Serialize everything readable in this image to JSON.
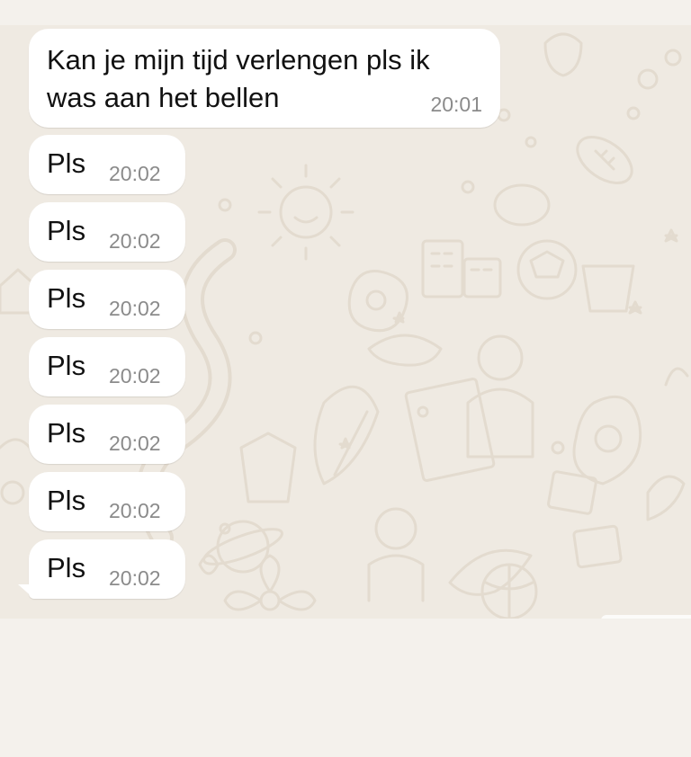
{
  "messages": [
    {
      "text": "Kan je mijn tijd verlengen pls ik was aan het bellen",
      "time": "20:01"
    },
    {
      "text": "Pls",
      "time": "20:02"
    },
    {
      "text": "Pls",
      "time": "20:02"
    },
    {
      "text": "Pls",
      "time": "20:02"
    },
    {
      "text": "Pls",
      "time": "20:02"
    },
    {
      "text": "Pls",
      "time": "20:02"
    },
    {
      "text": "Pls",
      "time": "20:02"
    },
    {
      "text": "Pls",
      "time": "20:02"
    }
  ],
  "colors": {
    "wallpaper": "#efeae2",
    "doodle": "#e3dbcf",
    "bubble": "#ffffff",
    "timestamp": "#8b8b8b"
  },
  "icons": [
    "chat-wallpaper-doodles"
  ]
}
